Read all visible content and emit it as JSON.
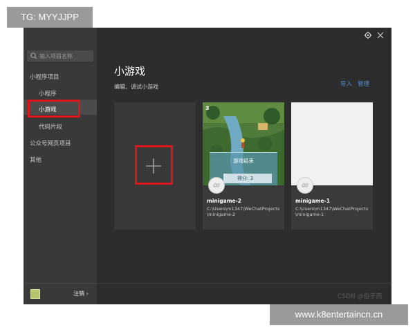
{
  "watermark_tag": "TG: MYYJJPP",
  "watermark_url": "www.k8entertaincn.cn",
  "footer_credit": "CSDN @伯子南",
  "search": {
    "placeholder": "输入项目名称"
  },
  "sidebar": {
    "items": [
      {
        "label": "小程序项目"
      },
      {
        "label": "小程序"
      },
      {
        "label": "小游戏"
      },
      {
        "label": "代码片段"
      },
      {
        "label": "公众号网页项目"
      },
      {
        "label": "其他"
      }
    ],
    "logout": "注销 ›"
  },
  "main": {
    "title": "小游戏",
    "subtitle": "编辑、调试小游戏",
    "import_label": "导入",
    "manage_label": "管理"
  },
  "projects": [
    {
      "name": "minigame-2",
      "path": "C:\\Users\\m1347\\WeChatProjects\\minigame-2",
      "thumb_number": "3",
      "dialog_title": "游戏结束",
      "dialog_score": "得分: 3"
    },
    {
      "name": "minigame-1",
      "path": "C:\\Users\\m1347\\WeChatProjects\\minigame-1"
    }
  ],
  "colors": {
    "accent_link": "#4a90d9",
    "highlight_red": "#e0141b",
    "window_bg": "#2d2d2d",
    "sidebar_bg": "#393939"
  }
}
